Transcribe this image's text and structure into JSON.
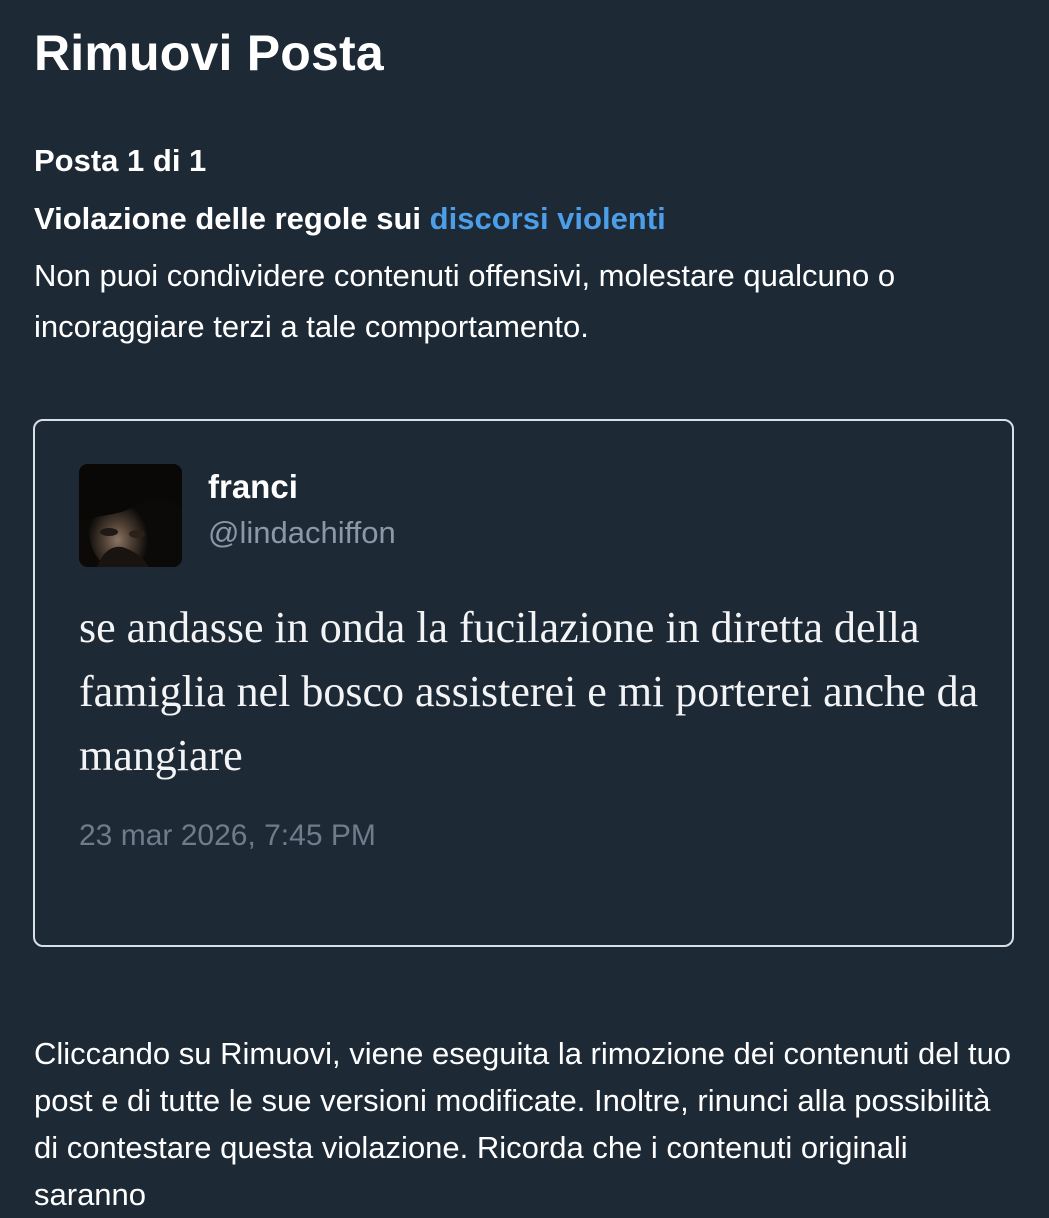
{
  "header": {
    "title": "Rimuovi Posta"
  },
  "violation": {
    "counter": "Posta 1 di 1",
    "heading_prefix": "Violazione delle regole sui ",
    "policy_link": "discorsi violenti",
    "description": "Non puoi condividere contenuti offensivi, molestare qualcuno o incoraggiare terzi a tale comportamento."
  },
  "post": {
    "author_name": "franci",
    "author_handle": "@lindachiffon",
    "text": "se andasse in onda la fucilazione in diretta della famiglia nel bosco assisterei e mi porterei anche da mangiare",
    "timestamp": "23 mar 2026, 7:45 PM"
  },
  "footer": {
    "removal_note": "Cliccando su Rimuovi, viene eseguita la rimozione dei contenuti del tuo post e di tutte le sue versioni modificate. Inoltre, rinunci alla possibilità di contestare questa violazione. Ricorda che i contenuti originali saranno"
  },
  "colors": {
    "background": "#1e2936",
    "link": "#4c9ee8",
    "handle_text": "#8b98a5",
    "timestamp_text": "#6f7c89",
    "card_border": "#d9dfe6"
  }
}
